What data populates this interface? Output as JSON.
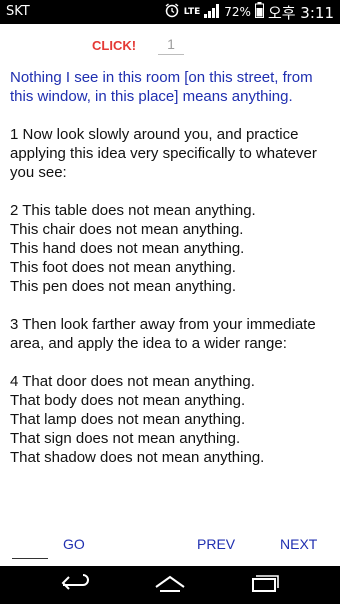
{
  "status_bar": {
    "carrier": "SKT",
    "lte": "LTE",
    "battery": "72%",
    "time": "오후 3:11"
  },
  "toolbar": {
    "click_label": "CLICK!",
    "page_value": "1"
  },
  "content": {
    "intro": "Nothing I see in this room [on this street, from this window, in this place] means anything.",
    "paragraphs": [
      "1 Now look slowly around you, and practice applying this idea very specifically to whatever you see:",
      "2 This table does not mean anything.\nThis chair does not mean anything.\nThis hand does not mean anything.\nThis foot does not mean anything.\nThis pen does not mean anything.",
      "3 Then look farther away from your immediate area, and apply the idea to a wider range:",
      "4 That door does not mean anything.\nThat body does not mean anything.\nThat lamp does not mean anything.\nThat sign does not mean anything.\nThat shadow does not mean anything."
    ]
  },
  "nav": {
    "go_label": "GO",
    "prev_label": "PREV",
    "next_label": "NEXT"
  },
  "icons": {
    "alarm": "alarm-clock-icon",
    "signal": "signal-icon",
    "battery": "battery-icon",
    "back": "back-arrow-icon",
    "home": "home-icon",
    "recent": "recent-apps-icon"
  },
  "colors": {
    "click": "#e53935",
    "intro_text": "#1f2fb0",
    "nav_text": "#1f2fb0",
    "status_bar_bg": "#000000"
  }
}
